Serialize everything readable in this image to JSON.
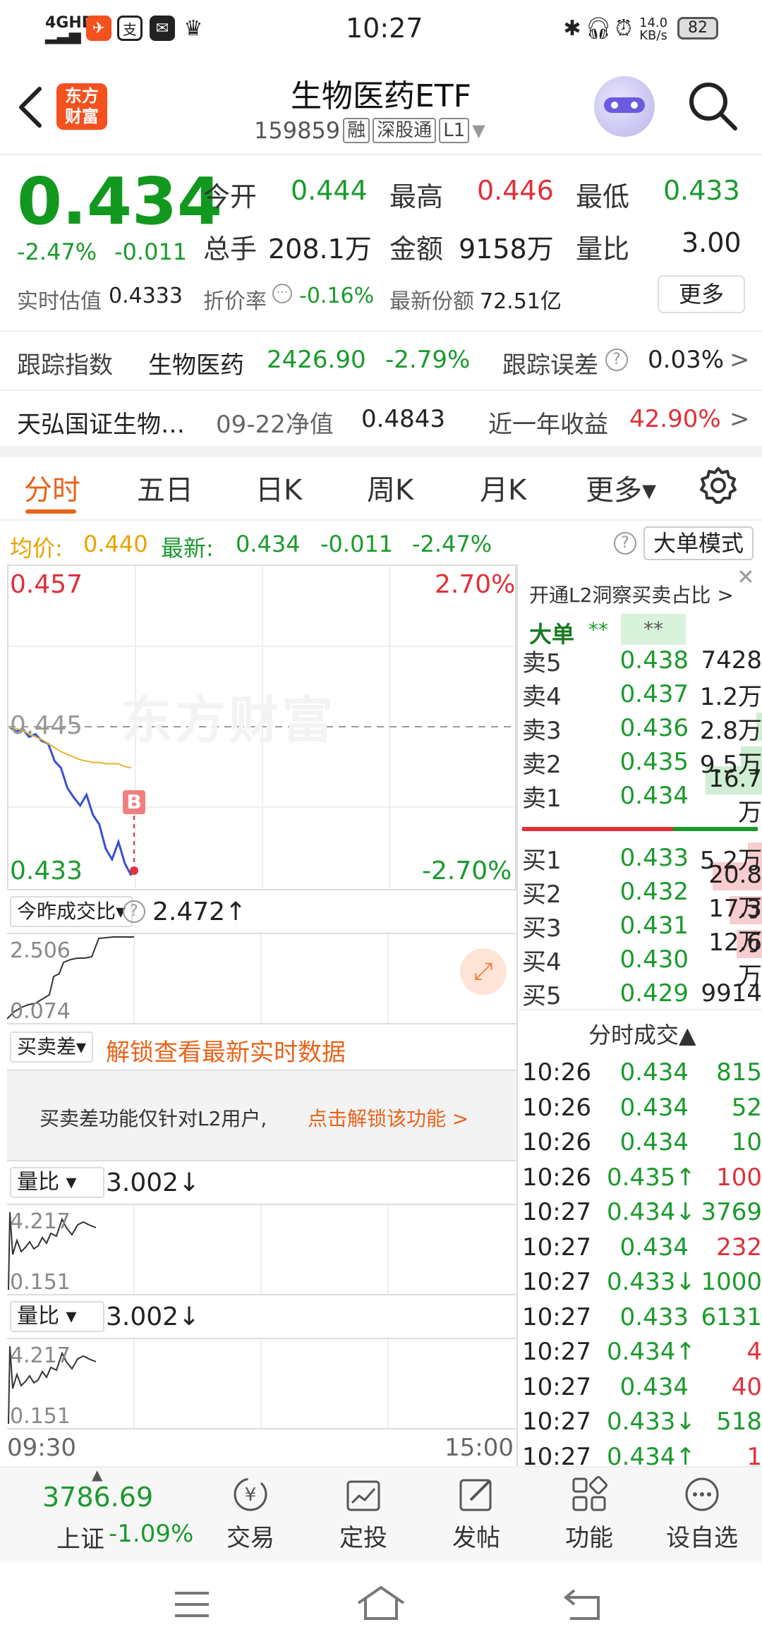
{
  "status_bar": {
    "network": "4GHD",
    "time": "10:27",
    "speed": "14.0",
    "speed_unit": "KB/s",
    "battery": "82"
  },
  "nav": {
    "logo_text_line1": "东方",
    "logo_text_line2": "财富",
    "title": "生物医药ETF",
    "code": "159859",
    "tag1": "融",
    "tag2": "深股通",
    "tag3": "L1"
  },
  "quote": {
    "price": "0.434",
    "change_pct": "-2.47%",
    "change": "-0.011",
    "open_label": "今开",
    "open": "0.444",
    "high_label": "最高",
    "high": "0.446",
    "low_label": "最低",
    "low": "0.433",
    "volume_label": "总手",
    "volume": "208.1万",
    "amount_label": "金额",
    "amount": "9158万",
    "ratio_label": "量比",
    "ratio": "3.00",
    "iopv_label": "实时估值",
    "iopv": "0.4333",
    "premium_label": "折价率",
    "premium": "-0.16%",
    "shares_label": "最新份额",
    "shares": "72.51亿",
    "more": "更多"
  },
  "tracking": {
    "label": "跟踪指数",
    "index_name": "生物医药",
    "index_value": "2426.90",
    "index_change": "-2.79%",
    "error_label": "跟踪误差",
    "error_value": "0.03%",
    "arrow": ">"
  },
  "fund_info": {
    "name": "天弘国证生物…",
    "nav_label": "09-22净值",
    "nav_value": "0.4843",
    "yield_label": "近一年收益",
    "yield_value": "42.90%",
    "arrow": ">"
  },
  "tabs": [
    "分时",
    "五日",
    "日K",
    "周K",
    "月K",
    "更多▾"
  ],
  "chart_header": {
    "avg_label": "均价:",
    "avg_value": "0.440",
    "latest_label": "最新:",
    "latest_value": "0.434",
    "change": "-0.011",
    "change_pct": "-2.47%",
    "big_order_mode": "大单模式"
  },
  "chart": {
    "y_max": "0.457",
    "y_max_pct": "2.70%",
    "y_mid": "0.445",
    "y_min": "0.433",
    "y_min_pct": "-2.70%",
    "marker": "B",
    "watermark": "东方财富",
    "time_start": "09:30",
    "time_end": "15:00"
  },
  "chart_data": {
    "type": "line",
    "series": [
      {
        "values": [
          0.445,
          0.4447,
          0.4449,
          0.4443,
          0.4445,
          0.444,
          0.4438,
          0.4425,
          0.442,
          0.4405,
          0.4398,
          0.4392,
          0.44,
          0.4385,
          0.4378,
          0.436,
          0.4352,
          0.4365,
          0.4349,
          0.434
        ]
      },
      {
        "values": [
          0.445,
          0.4449,
          0.4448,
          0.4445,
          0.4443,
          0.4441,
          0.4438,
          0.4435,
          0.4432,
          0.443,
          0.4428,
          0.4426,
          0.4425,
          0.4424,
          0.4424,
          0.4423,
          0.4423,
          0.4423,
          0.4421,
          0.442
        ]
      }
    ],
    "ylim": [
      0.433,
      0.457
    ]
  },
  "sub1": {
    "dropdown": "今昨成交比▾",
    "value": "2.472↑",
    "max": "2.506",
    "min": "0.074"
  },
  "sub2": {
    "dropdown": "买卖差▾",
    "unlock_title": "解锁查看最新实时数据",
    "notice": "买卖差功能仅针对L2用户,",
    "notice_link": "点击解锁该功能 >"
  },
  "sub3": {
    "dropdown": "量比 ▾",
    "value": "3.002↓",
    "max": "4.217",
    "min": "0.151"
  },
  "sub4": {
    "dropdown": "量比 ▾",
    "value": "3.002↓",
    "max": "4.217",
    "min": "0.151"
  },
  "orderbook": {
    "promo": "开通L2洞察买卖占比 >",
    "big_label": "大单",
    "big_val1": "**",
    "big_val2": "**",
    "asks": [
      {
        "label": "卖5",
        "price": "0.438",
        "vol": "7428"
      },
      {
        "label": "卖4",
        "price": "0.437",
        "vol": "1.2万"
      },
      {
        "label": "卖3",
        "price": "0.436",
        "vol": "2.8万"
      },
      {
        "label": "卖2",
        "price": "0.435",
        "vol": "9.5万"
      },
      {
        "label": "卖1",
        "price": "0.434",
        "vol": "16.7万"
      }
    ],
    "bids": [
      {
        "label": "买1",
        "price": "0.433",
        "vol": "5.2万"
      },
      {
        "label": "买2",
        "price": "0.432",
        "vol": "20.8万"
      },
      {
        "label": "买3",
        "price": "0.431",
        "vol": "17.3万"
      },
      {
        "label": "买4",
        "price": "0.430",
        "vol": "12.6万"
      },
      {
        "label": "买5",
        "price": "0.429",
        "vol": "9914"
      }
    ],
    "trades_title": "分时成交▲",
    "trades": [
      {
        "time": "10:26",
        "price": "0.434",
        "vol": "815",
        "color": "green"
      },
      {
        "time": "10:26",
        "price": "0.434",
        "vol": "52",
        "color": "green"
      },
      {
        "time": "10:26",
        "price": "0.434",
        "vol": "10",
        "color": "green"
      },
      {
        "time": "10:26",
        "price": "0.435↑",
        "vol": "100",
        "color": "red"
      },
      {
        "time": "10:27",
        "price": "0.434↓",
        "vol": "3769",
        "color": "green"
      },
      {
        "time": "10:27",
        "price": "0.434",
        "vol": "232",
        "color": "red"
      },
      {
        "time": "10:27",
        "price": "0.433↓",
        "vol": "1000",
        "color": "green"
      },
      {
        "time": "10:27",
        "price": "0.433",
        "vol": "6131",
        "color": "green"
      },
      {
        "time": "10:27",
        "price": "0.434↑",
        "vol": "4",
        "color": "red"
      },
      {
        "time": "10:27",
        "price": "0.434",
        "vol": "40",
        "color": "red"
      },
      {
        "time": "10:27",
        "price": "0.433↓",
        "vol": "518",
        "color": "green"
      },
      {
        "time": "10:27",
        "price": "0.434↑",
        "vol": "1",
        "color": "red"
      }
    ]
  },
  "bottom_bar": {
    "index_value": "3786.69",
    "index_name": "上证",
    "index_change": "-1.09%",
    "items": [
      "交易",
      "定投",
      "发帖",
      "功能",
      "设自选"
    ]
  }
}
